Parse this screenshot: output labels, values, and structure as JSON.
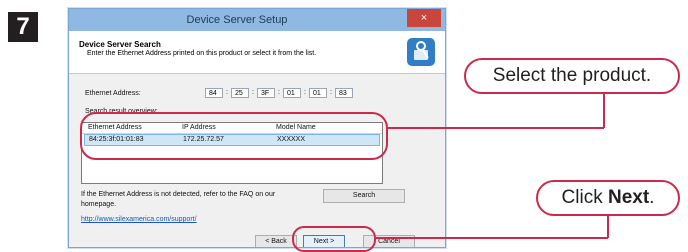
{
  "step_number": "7",
  "window": {
    "title": "Device Server Setup",
    "close_glyph": "×",
    "header_title": "Device Server Search",
    "header_subtitle": "Enter the Ethernet Address printed on this product or select it from the list.",
    "header_icon": "device-gear-icon"
  },
  "ethernet": {
    "label": "Ethernet Address:",
    "octets": [
      "84",
      "25",
      "3F",
      "01",
      "01",
      "83"
    ],
    "separator": ":"
  },
  "results": {
    "label": "Search result overview:",
    "columns": [
      "Ethernet Address",
      "IP Address",
      "Model Name"
    ],
    "rows": [
      {
        "ethernet": "84:25:3f:01:01:83",
        "ip": "172.25.72.57",
        "model": "XXXXXX"
      }
    ]
  },
  "help": {
    "line1": "If the Ethernet Address is not detected, refer to the FAQ on our",
    "line2": "homepage.",
    "link": "http://www.silexamerica.com/support/"
  },
  "buttons": {
    "search": "Search",
    "back": "< Back",
    "next": "Next >",
    "cancel": "Cancel"
  },
  "callouts": {
    "select": "Select the product.",
    "click_prefix": "Click ",
    "click_bold": "Next",
    "click_suffix": "."
  },
  "colors": {
    "accent": "#cc2a4d",
    "titlebar": "#8fb8e3",
    "selection": "#cfe6f7",
    "link": "#1a57b8"
  }
}
